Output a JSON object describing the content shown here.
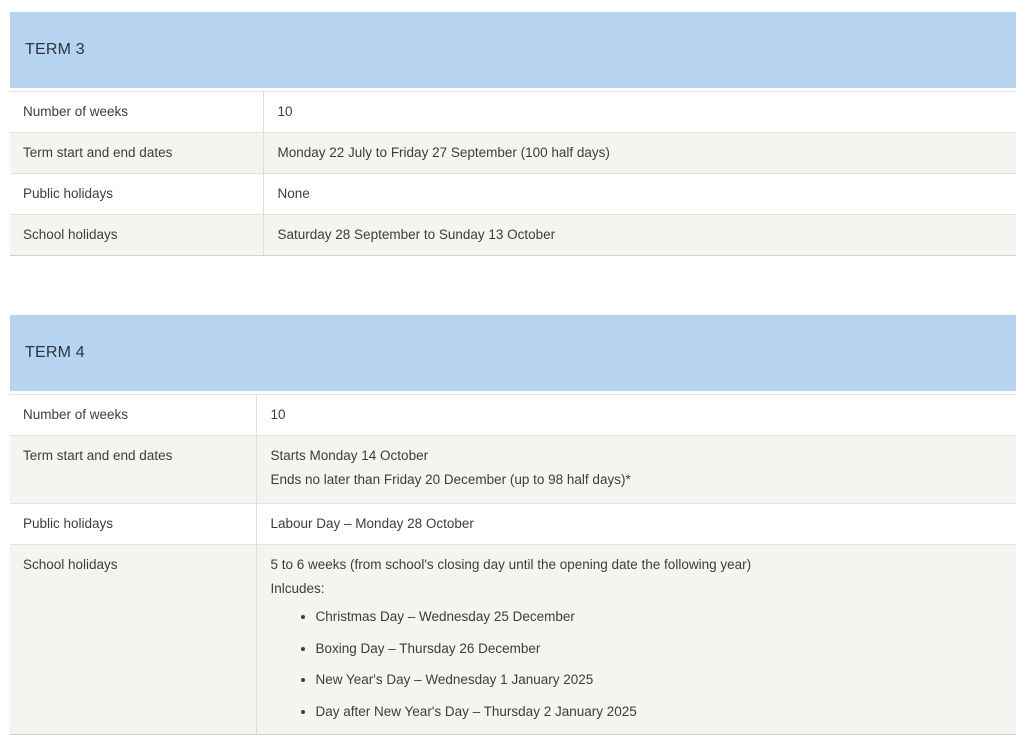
{
  "term3": {
    "title": "TERM 3",
    "rows": [
      {
        "label": "Number of weeks",
        "value": "10"
      },
      {
        "label": "Term start and end dates",
        "value": "Monday 22 July to Friday 27 September (100 half days)"
      },
      {
        "label": "Public holidays",
        "value": "None"
      },
      {
        "label": "School holidays",
        "value": "Saturday 28 September to Sunday 13 October"
      }
    ]
  },
  "term4": {
    "title": "TERM 4",
    "weeks_label": "Number of weeks",
    "weeks_value": "10",
    "dates_label": "Term start and end dates",
    "dates_line1": "Starts Monday 14 October",
    "dates_line2": "Ends no later than Friday 20 December (up to 98 half days)*",
    "public_label": "Public holidays",
    "public_value": "Labour Day – Monday 28 October",
    "school_label": "School holidays",
    "school_line1": "5 to 6 weeks (from school's closing day until the opening date the following year)",
    "school_line2": "Inlcudes:",
    "school_items": [
      "Christmas Day – Wednesday 25 December",
      "Boxing Day – Thursday 26 December",
      "New Year's Day – Wednesday 1 January 2025",
      "Day after New Year's Day – Thursday 2 January 2025"
    ]
  }
}
